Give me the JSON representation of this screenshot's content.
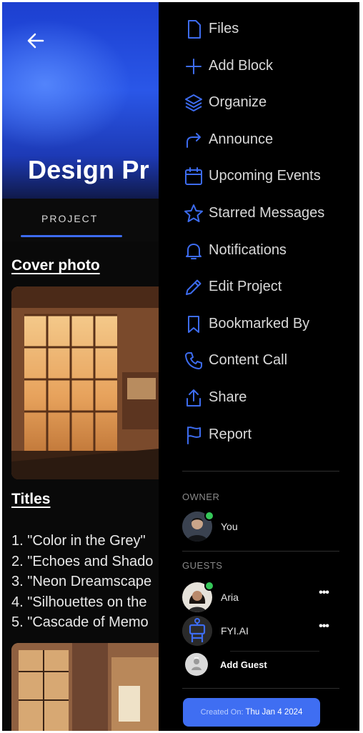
{
  "project_page": {
    "title": "Design Pr",
    "tab": "PROJECT",
    "cover_heading": "Cover photo",
    "titles_heading": "Titles",
    "titles": [
      "1. \"Color in the Grey\"",
      "2. \"Echoes and Shado",
      "3. \"Neon Dreamscape",
      "4. \"Silhouettes on the",
      "5. \"Cascade of Memo"
    ]
  },
  "drawer": {
    "menu": [
      {
        "label": "Files",
        "icon": "file-icon"
      },
      {
        "label": "Add Block",
        "icon": "plus-icon"
      },
      {
        "label": "Organize",
        "icon": "layers-icon"
      },
      {
        "label": "Announce",
        "icon": "share-arrow-icon"
      },
      {
        "label": "Upcoming Events",
        "icon": "calendar-icon"
      },
      {
        "label": "Starred Messages",
        "icon": "star-icon"
      },
      {
        "label": "Notifications",
        "icon": "bell-icon"
      },
      {
        "label": "Edit Project",
        "icon": "pencil-icon"
      },
      {
        "label": "Bookmarked By",
        "icon": "bookmark-icon"
      },
      {
        "label": "Content Call",
        "icon": "phone-icon"
      },
      {
        "label": "Share",
        "icon": "upload-icon"
      },
      {
        "label": "Report",
        "icon": "flag-icon"
      }
    ],
    "owner_label": "OWNER",
    "owner": {
      "name": "You"
    },
    "guests_label": "GUESTS",
    "guests": [
      {
        "name": "Aria",
        "more": "•••"
      },
      {
        "name": "FYI.AI",
        "more": "•••"
      }
    ],
    "add_guest": "Add Guest",
    "created_label": "Created On:",
    "created_date": "Thu Jan 4 2024"
  },
  "colors": {
    "accent": "#3f6ef2",
    "icon_blue": "#3d6cf0",
    "online": "#35c759",
    "drawer_bg": "#000000"
  }
}
